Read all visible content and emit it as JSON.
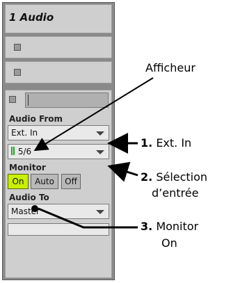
{
  "track": {
    "title": "1 Audio"
  },
  "audio_from": {
    "label": "Audio From",
    "source": "Ext. In",
    "channel": "5/6"
  },
  "monitor": {
    "label": "Monitor",
    "buttons": [
      "On",
      "Auto",
      "Off"
    ],
    "active": "On",
    "active_color": "#c8f000"
  },
  "audio_to": {
    "label": "Audio To",
    "destination": "Master"
  },
  "callouts": {
    "display": "Afficheur",
    "c1_num": "1.",
    "c1_text": "Ext. In",
    "c2_num": "2.",
    "c2_text_line1": "Sélection",
    "c2_text_line2": "d’entrée",
    "c3_num": "3.",
    "c3_text_line1": "Monitor",
    "c3_text_line2": "On"
  }
}
